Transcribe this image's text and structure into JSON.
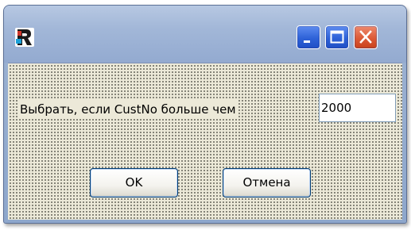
{
  "window": {
    "title": "",
    "controls": {
      "minimize_icon": "minimize-icon",
      "maximize_icon": "maximize-icon",
      "close_icon": "close-icon"
    }
  },
  "form": {
    "label": "Выбрать, если CustNo больше чем",
    "input_value": "2000",
    "ok_label": "OK",
    "cancel_label": "Отмена"
  },
  "colors": {
    "titlebar": "#9fb4d6",
    "client_background": "#ece9d8",
    "grid_dots": "#6b6a60",
    "close_button": "#dc5a36",
    "control_button": "#2e62d8"
  }
}
